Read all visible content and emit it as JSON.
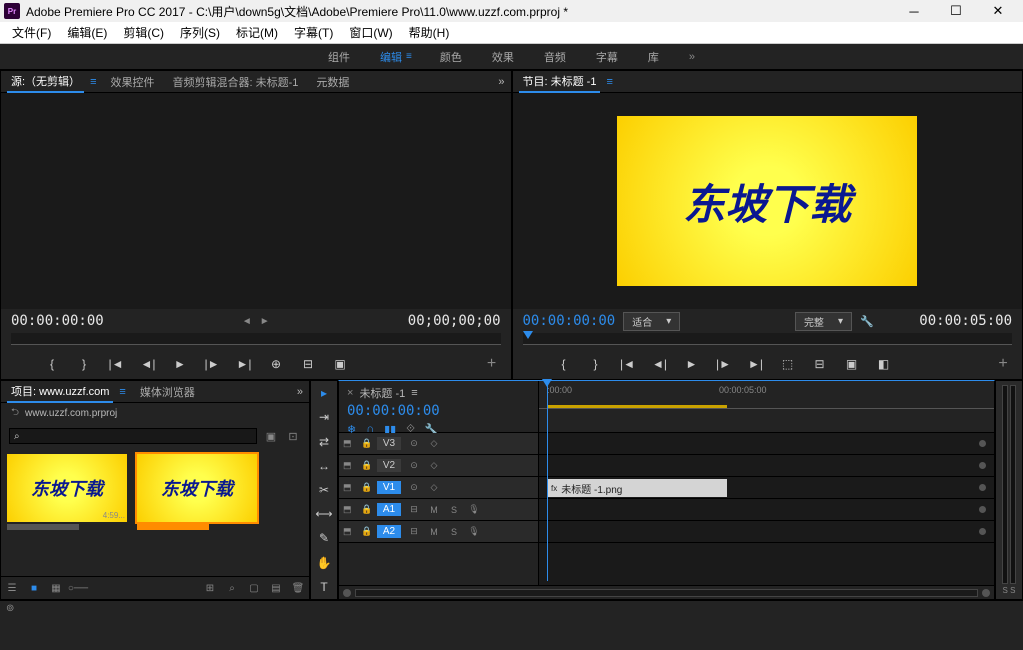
{
  "titlebar": {
    "app_icon": "Pr",
    "title": "Adobe Premiere Pro CC 2017 - C:\\用户\\down5g\\文档\\Adobe\\Premiere Pro\\11.0\\www.uzzf.com.prproj *"
  },
  "menubar": [
    "文件(F)",
    "编辑(E)",
    "剪辑(C)",
    "序列(S)",
    "标记(M)",
    "字幕(T)",
    "窗口(W)",
    "帮助(H)"
  ],
  "workspaces": {
    "items": [
      "组件",
      "编辑",
      "颜色",
      "效果",
      "音频",
      "字幕",
      "库"
    ],
    "active_index": 1
  },
  "source_panel": {
    "tabs": [
      "源:（无剪辑）",
      "效果控件",
      "音频剪辑混合器: 未标题-1",
      "元数据"
    ],
    "active": 0,
    "tc_left": "00:00:00:00",
    "fit_label": "",
    "tc_right": "00;00;00;00"
  },
  "program_panel": {
    "title": "节目: 未标题 -1",
    "preview_text": "东坡下载",
    "tc_left": "00:00:00:00",
    "fit": "适合",
    "quality": "完整",
    "tc_right": "00:00:05:00"
  },
  "project_panel": {
    "tabs": [
      "项目: www.uzzf.com",
      "媒体浏览器"
    ],
    "active": 0,
    "path": "www.uzzf.com.prproj",
    "search_placeholder": "",
    "bins": [
      {
        "text": "东坡下载",
        "duration": "4:59...",
        "selected": false
      },
      {
        "text": "东坡下载",
        "duration": "",
        "selected": true
      }
    ]
  },
  "timeline": {
    "title": "未标题 -1",
    "tc": "00:00:00:00",
    "ruler_ticks": [
      {
        "label": ":00:00",
        "pos": 8
      },
      {
        "label": "00:00:05:00",
        "pos": 180
      }
    ],
    "tracks_video": [
      {
        "name": "V3",
        "active": false
      },
      {
        "name": "V2",
        "active": false
      },
      {
        "name": "V1",
        "active": true
      }
    ],
    "tracks_audio": [
      {
        "name": "A1",
        "active": true
      },
      {
        "name": "A2",
        "active": true
      }
    ],
    "clip_name": "未标题 -1.png",
    "audio_label": "S  S"
  }
}
